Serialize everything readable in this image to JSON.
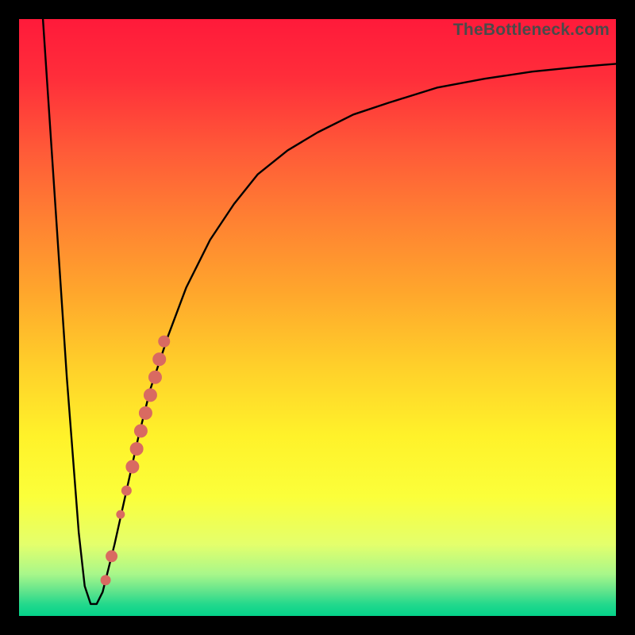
{
  "watermark": "TheBottleneck.com",
  "colors": {
    "curve_stroke": "#000000",
    "marker_fill": "#d96a61",
    "marker_stroke": "#d96a61"
  },
  "chart_data": {
    "type": "line",
    "title": "",
    "xlabel": "",
    "ylabel": "",
    "xlim": [
      0,
      100
    ],
    "ylim": [
      0,
      100
    ],
    "grid": false,
    "series": [
      {
        "name": "bottleneck-curve",
        "x": [
          4,
          6,
          8,
          10,
          11,
          12,
          13,
          14,
          16,
          18,
          20,
          22,
          25,
          28,
          32,
          36,
          40,
          45,
          50,
          56,
          62,
          70,
          78,
          86,
          94,
          100
        ],
        "y": [
          100,
          70,
          40,
          14,
          5,
          2,
          2,
          4,
          12,
          21,
          30,
          38,
          47,
          55,
          63,
          69,
          74,
          78,
          81,
          84,
          86,
          88.5,
          90,
          91.2,
          92,
          92.5
        ]
      }
    ],
    "markers": [
      {
        "x": 14.5,
        "y": 6,
        "r": 6
      },
      {
        "x": 15.5,
        "y": 10,
        "r": 7
      },
      {
        "x": 17.0,
        "y": 17,
        "r": 5
      },
      {
        "x": 18.0,
        "y": 21,
        "r": 6
      },
      {
        "x": 19.0,
        "y": 25,
        "r": 8
      },
      {
        "x": 19.7,
        "y": 28,
        "r": 8
      },
      {
        "x": 20.4,
        "y": 31,
        "r": 8
      },
      {
        "x": 21.2,
        "y": 34,
        "r": 8
      },
      {
        "x": 22.0,
        "y": 37,
        "r": 8
      },
      {
        "x": 22.8,
        "y": 40,
        "r": 8
      },
      {
        "x": 23.5,
        "y": 43,
        "r": 8
      },
      {
        "x": 24.3,
        "y": 46,
        "r": 7
      }
    ]
  }
}
